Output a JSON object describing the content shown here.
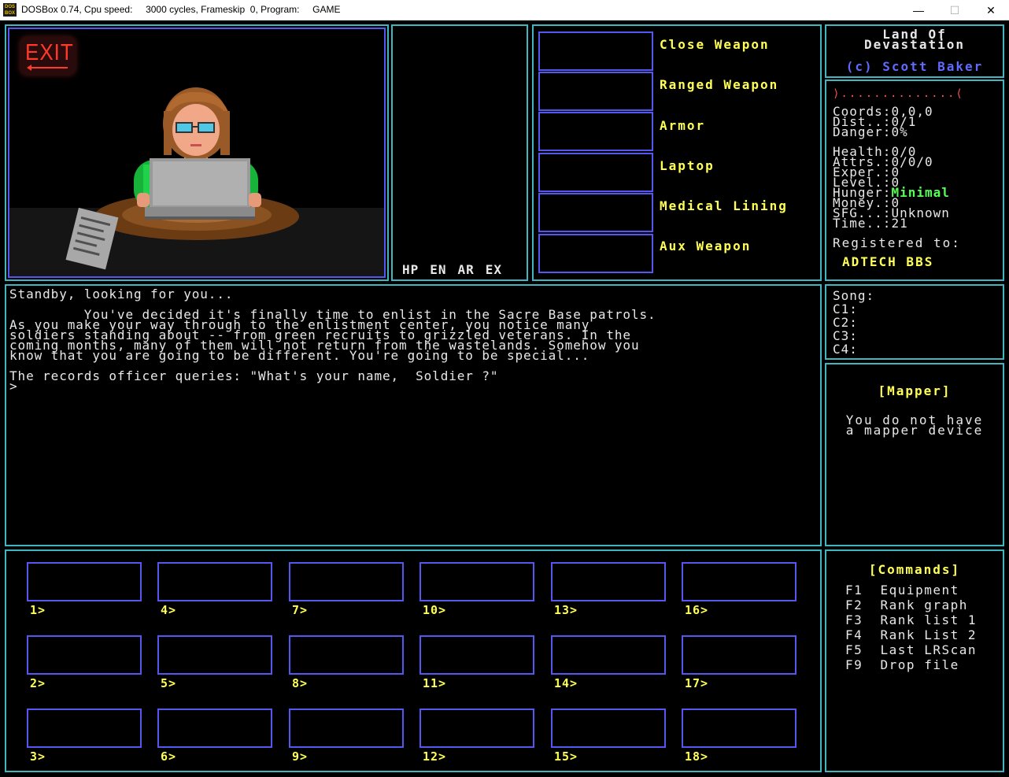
{
  "window": {
    "title": "DOSBox 0.74, Cpu speed:     3000 cycles, Frameskip  0, Program:     GAME",
    "icon_text_top": "DOS",
    "icon_text_bottom": "BOX",
    "minimize": "—",
    "maximize": "☐",
    "close": "✕"
  },
  "scene": {
    "exit_sign": "EXIT"
  },
  "vitals": {
    "labels": [
      "HP",
      "EN",
      "AR",
      "EX"
    ]
  },
  "equipment": {
    "slots": [
      {
        "label": "Close Weapon"
      },
      {
        "label": "Ranged Weapon"
      },
      {
        "label": "Armor"
      },
      {
        "label": "Laptop"
      },
      {
        "label": "Medical Lining"
      },
      {
        "label": "Aux Weapon"
      }
    ]
  },
  "title_box": {
    "line1": "Land Of",
    "line2": "Devastation",
    "credit": "(c) Scott Baker"
  },
  "stats": {
    "bar": "⟩..............⟨",
    "rows": [
      {
        "label": "Coords:",
        "value": "0,0,0"
      },
      {
        "label": "Dist..:",
        "value": "0/1"
      },
      {
        "label": "Danger:",
        "value": "0%"
      },
      {
        "label": "Health:",
        "value": "0/0"
      },
      {
        "label": "Attrs.:",
        "value": "0/0/0"
      },
      {
        "label": "Exper.:",
        "value": "0"
      },
      {
        "label": "Level.:",
        "value": "0"
      },
      {
        "label": "Hunger:",
        "value": "Minimal"
      },
      {
        "label": "Money.:",
        "value": "0"
      },
      {
        "label": "SFG...:",
        "value": "Unknown"
      },
      {
        "label": "Time..:",
        "value": "21"
      }
    ],
    "registered_label": "Registered to:",
    "registered_name": "ADTECH BBS"
  },
  "message": {
    "text": "Standby, looking for you...\n\n         You've decided it's finally time to enlist in the Sacre Base patrols.\nAs you make your way through to the enlistment center, you notice many\nsoldiers standing about -- from green recruits to grizzled veterans. In the\ncoming months, many of them will not return from the wastelands. Somehow you\nknow that you are going to be different. You're going to be special...\n\nThe records officer queries: \"What's your name,  Soldier ?\"\n>"
  },
  "song": {
    "title": "Song:",
    "channels": [
      "C1:",
      "C2:",
      "C3:",
      "C4:"
    ]
  },
  "mapper": {
    "title": "[Mapper]",
    "line1": "You do not have",
    "line2": "a mapper device"
  },
  "inventory": {
    "slots": [
      "1>",
      "4>",
      "7>",
      "10>",
      "13>",
      "16>",
      "2>",
      "5>",
      "8>",
      "11>",
      "14>",
      "17>",
      "3>",
      "6>",
      "9>",
      "12>",
      "15>",
      "18>"
    ]
  },
  "commands": {
    "title": "[Commands]",
    "items": [
      {
        "key": "F1",
        "label": "Equipment"
      },
      {
        "key": "F2",
        "label": "Rank graph"
      },
      {
        "key": "F3",
        "label": "Rank list 1"
      },
      {
        "key": "F4",
        "label": "Rank List 2"
      },
      {
        "key": "F5",
        "label": "Last LRScan"
      },
      {
        "key": "F9",
        "label": "Drop file"
      }
    ]
  },
  "colors": {
    "panel_border": "#3fb6c0",
    "slot_border": "#5558f0",
    "label_yellow": "#ffff55",
    "text_white": "#e8e8e8",
    "status_green": "#55ff55",
    "credit_blue": "#5f6bff"
  }
}
